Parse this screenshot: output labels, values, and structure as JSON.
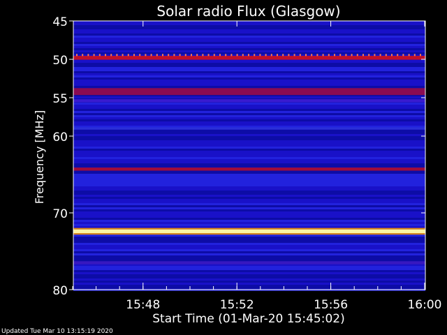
{
  "chart_data": {
    "type": "heatmap",
    "title": "Solar radio Flux (Glasgow)",
    "xlabel": "Start Time (01-Mar-20 15:45:02)",
    "ylabel": "Frequency [MHz]",
    "footer": "Updated Tue Mar 10 13:15:19 2020",
    "y_axis": {
      "range": [
        45,
        80
      ],
      "inverted": true,
      "ticks": [
        45,
        50,
        55,
        60,
        70,
        80
      ],
      "tick_labels": [
        "45",
        "50",
        "55",
        "60",
        "70",
        "80"
      ]
    },
    "x_axis": {
      "range_minutes": [
        0,
        15
      ],
      "ticks_minutes": [
        2.97,
        6.97,
        10.97,
        14.97
      ],
      "tick_labels": [
        "15:48",
        "15:52",
        "15:56",
        "16:00"
      ]
    },
    "bands": [
      {
        "freq": 49.8,
        "width": 0.5,
        "color": "#c0102a"
      },
      {
        "freq": 54.2,
        "width": 0.9,
        "color": "#8a0b52"
      },
      {
        "freq": 55.4,
        "width": 0.4,
        "color": "#3a1bd0"
      },
      {
        "freq": 59.0,
        "width": 0.3,
        "color": "#2a2fd8"
      },
      {
        "freq": 64.3,
        "width": 0.4,
        "color": "#a00c3a"
      },
      {
        "freq": 72.4,
        "width": 0.5,
        "color": "#fff4a0"
      },
      {
        "freq": 76.5,
        "width": 0.4,
        "color": "#3818c0"
      }
    ],
    "colors": {
      "background": "#000000",
      "base": "#1a12c8",
      "axis": "#ffffff"
    }
  }
}
